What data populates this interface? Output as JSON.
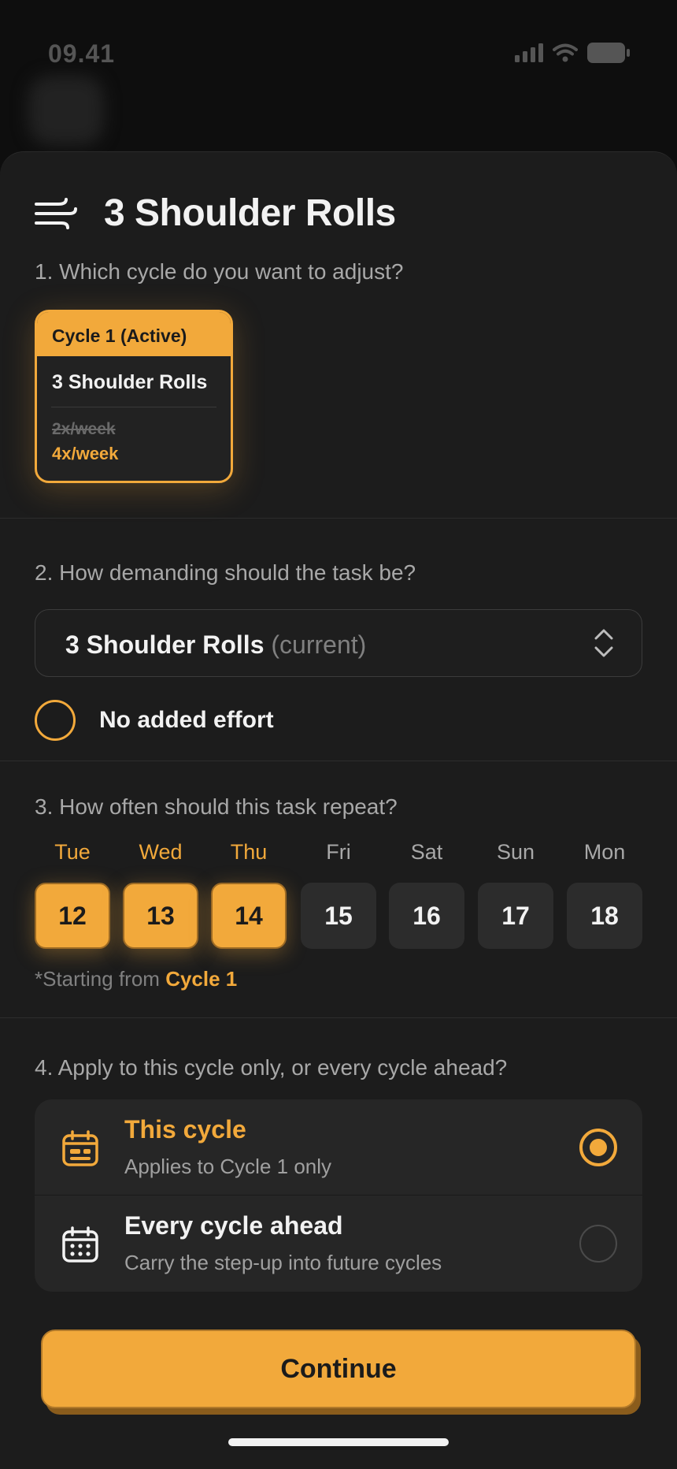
{
  "status_bar": {
    "time": "09.41"
  },
  "header": {
    "title": "3 Shoulder Rolls",
    "icon": "wind-lines-icon"
  },
  "section1": {
    "question": "1. Which cycle do you want to adjust?",
    "card": {
      "header": "Cycle 1 (Active)",
      "task": "3 Shoulder Rolls",
      "old_frequency": "2x/week",
      "new_frequency": "4x/week"
    }
  },
  "section2": {
    "question": "2. How demanding should the task be?",
    "select_value": "3 Shoulder Rolls",
    "select_suffix": "(current)",
    "effort_label": "No added effort"
  },
  "section3": {
    "question": "3. How often should this task repeat?",
    "days": [
      {
        "name": "Tue",
        "num": "12",
        "selected": true
      },
      {
        "name": "Wed",
        "num": "13",
        "selected": true
      },
      {
        "name": "Thu",
        "num": "14",
        "selected": true
      },
      {
        "name": "Fri",
        "num": "15",
        "selected": false
      },
      {
        "name": "Sat",
        "num": "16",
        "selected": false
      },
      {
        "name": "Sun",
        "num": "17",
        "selected": false
      },
      {
        "name": "Mon",
        "num": "18",
        "selected": false
      }
    ],
    "starting_prefix": "*Starting from",
    "starting_cycle": "Cycle 1"
  },
  "section4": {
    "question": "4. Apply to this cycle only, or every cycle ahead?",
    "options": [
      {
        "title": "This cycle",
        "subtitle": "Applies to Cycle 1 only",
        "selected": true,
        "icon": "calendar-card-icon"
      },
      {
        "title": "Every cycle ahead",
        "subtitle": "Carry the step-up into future cycles",
        "selected": false,
        "icon": "calendar-grid-icon"
      }
    ]
  },
  "continue_label": "Continue",
  "colors": {
    "accent": "#f2a93b",
    "background": "#1c1c1c"
  }
}
